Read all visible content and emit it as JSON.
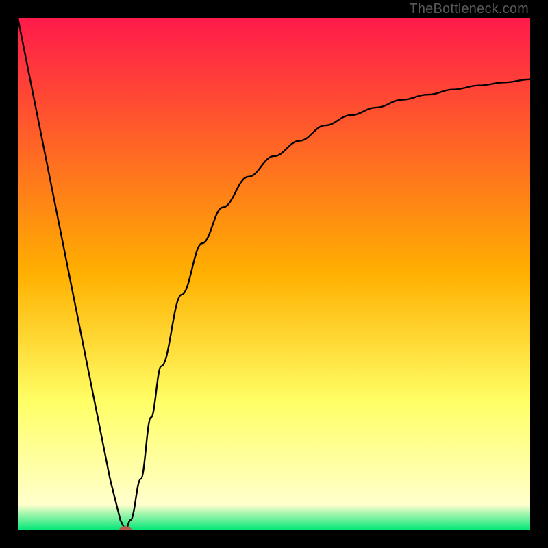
{
  "watermark": "TheBottleneck.com",
  "chart_data": {
    "type": "line",
    "title": "",
    "xlabel": "",
    "ylabel": "",
    "xlim": [
      0,
      100
    ],
    "ylim": [
      0,
      100
    ],
    "grid": false,
    "legend": false,
    "background_gradient": {
      "stops": [
        {
          "offset": 0.0,
          "color": "#ff1a4b"
        },
        {
          "offset": 0.5,
          "color": "#ffb000"
        },
        {
          "offset": 0.75,
          "color": "#ffff66"
        },
        {
          "offset": 0.95,
          "color": "#ffffcc"
        },
        {
          "offset": 1.0,
          "color": "#00e676"
        }
      ]
    },
    "series": [
      {
        "name": "bottleneck-curve",
        "x": [
          0,
          4,
          8,
          12,
          16,
          18,
          20,
          21,
          22,
          24,
          26,
          28,
          32,
          36,
          40,
          45,
          50,
          55,
          60,
          65,
          70,
          75,
          80,
          85,
          90,
          95,
          100
        ],
        "y": [
          100,
          80,
          60,
          40,
          20,
          10,
          2,
          0,
          2,
          10,
          22,
          32,
          46,
          56,
          63,
          69,
          73,
          76,
          79,
          81,
          82.5,
          84,
          85,
          86,
          86.8,
          87.4,
          88
        ]
      }
    ],
    "marker": {
      "x": 21,
      "y": 0,
      "color": "#b65a4b",
      "rx": 9,
      "ry": 6
    }
  }
}
